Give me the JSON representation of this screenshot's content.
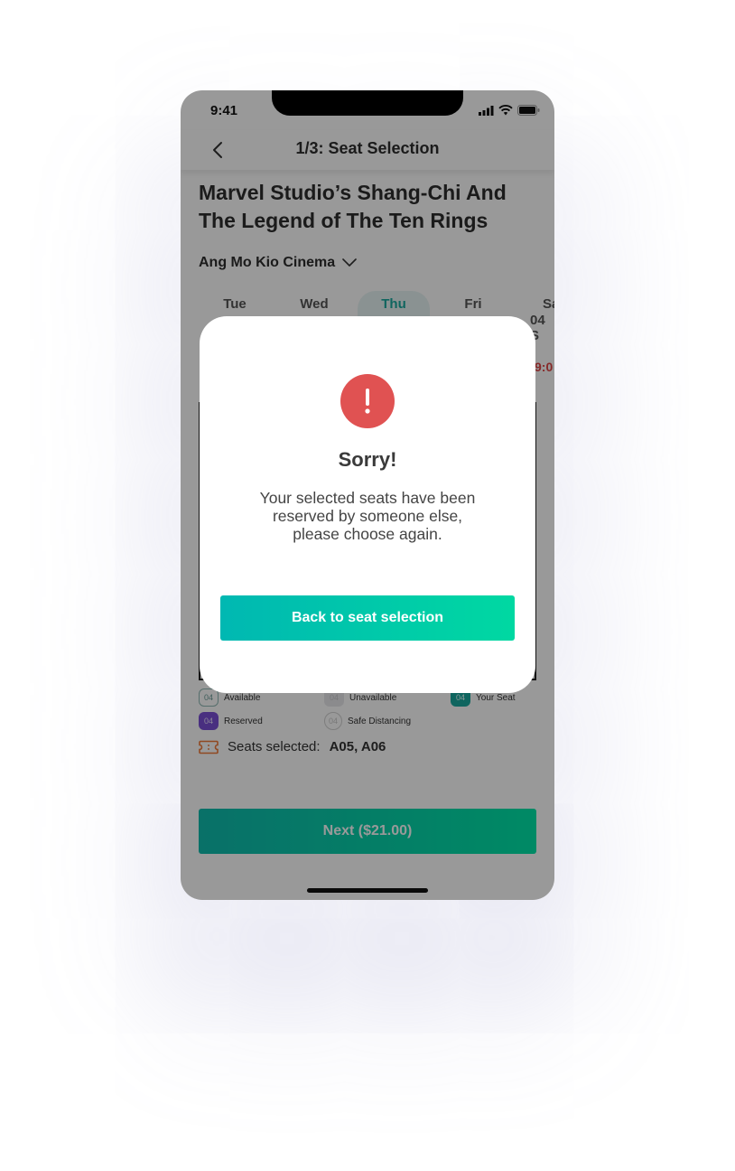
{
  "status_bar": {
    "time": "9:41"
  },
  "nav": {
    "title": "1/3: Seat Selection"
  },
  "movie": {
    "title_line1": "Marvel Studio’s Shang-Chi And",
    "title_line2": "The Legend of The Ten Rings"
  },
  "cinema": {
    "name": "Ang Mo Kio Cinema"
  },
  "dates": {
    "days": [
      "Tue",
      "Wed",
      "Thu",
      "Fri",
      "Sa"
    ],
    "active_index": 2,
    "partial_sub": "04 S",
    "partial_time": "9:0"
  },
  "legend": {
    "seat_number": "04",
    "available": "Available",
    "unavailable": "Unavailable",
    "your_seat": "Your Seat",
    "reserved": "Reserved",
    "safe_distancing": "Safe Distancing"
  },
  "selection": {
    "label": "Seats selected:",
    "seats": "A05, A06"
  },
  "next_button": {
    "label": "Next ($21.00)"
  },
  "modal": {
    "title": "Sorry!",
    "message_line1": "Your selected seats have been",
    "message_line2": "reserved by someone else,",
    "message_line3": "please choose again.",
    "button_label": "Back to seat selection"
  },
  "colors": {
    "accent": "#1aa89e",
    "alert": "#e05252",
    "reserved": "#7b4fd6"
  }
}
